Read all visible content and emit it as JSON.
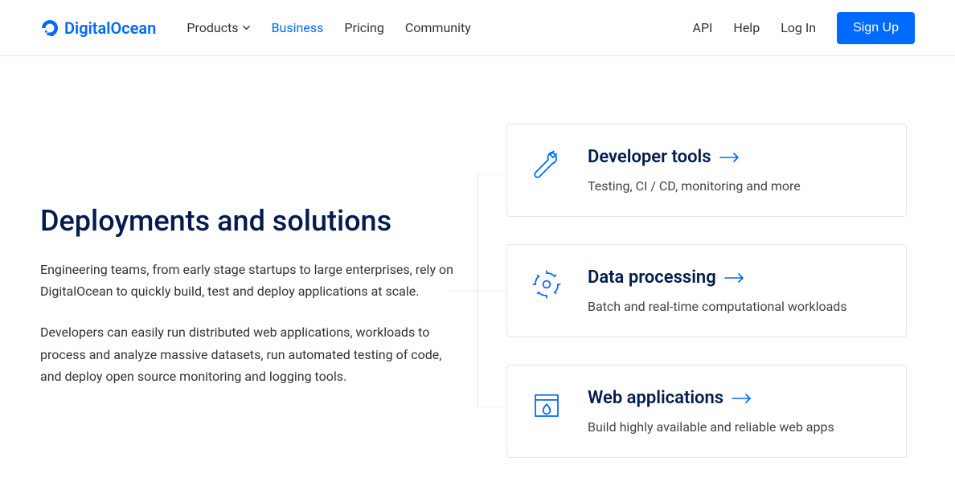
{
  "brand": "DigitalOcean",
  "nav": {
    "products": "Products",
    "business": "Business",
    "pricing": "Pricing",
    "community": "Community",
    "api": "API",
    "help": "Help",
    "login": "Log In",
    "signup": "Sign Up"
  },
  "heading": "Deployments and solutions",
  "para1": "Engineering teams, from early stage startups to large enterprises, rely on DigitalOcean to quickly build, test and deploy applications at scale.",
  "para2": "Developers can easily run distributed web applications, workloads to process and analyze massive datasets, run automated testing of code, and deploy open source monitoring and logging tools.",
  "cards": [
    {
      "title": "Developer tools",
      "desc": "Testing, CI / CD, monitoring and more"
    },
    {
      "title": "Data processing",
      "desc": "Batch and real-time computational workloads"
    },
    {
      "title": "Web applications",
      "desc": "Build highly available and reliable web apps"
    }
  ]
}
